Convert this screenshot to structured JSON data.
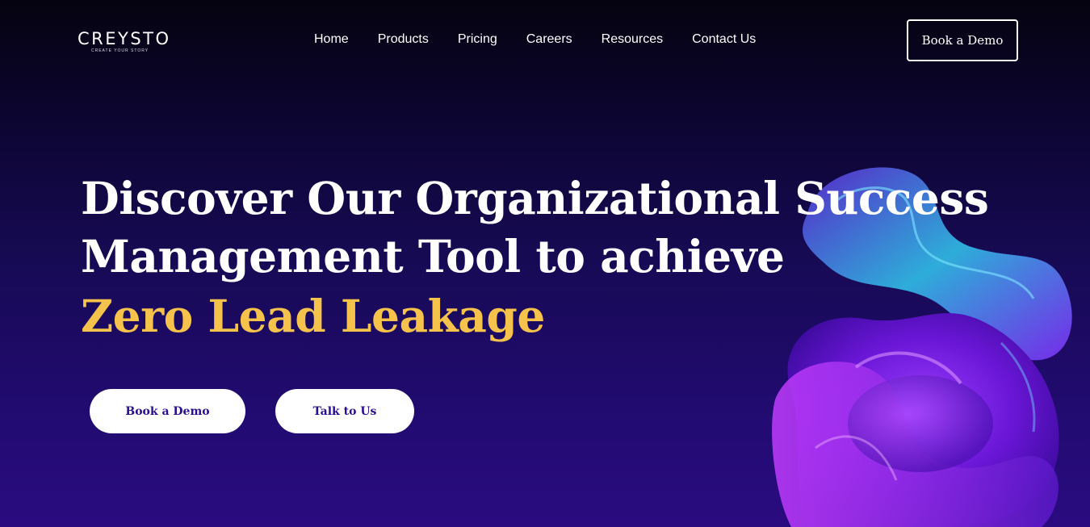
{
  "brand": {
    "name": "CREYSTO",
    "tagline": "CREATE YOUR STORY"
  },
  "nav": {
    "items": [
      {
        "label": "Home"
      },
      {
        "label": "Products"
      },
      {
        "label": "Pricing"
      },
      {
        "label": "Careers"
      },
      {
        "label": "Resources"
      },
      {
        "label": "Contact Us"
      }
    ],
    "cta_label": "Book a Demo"
  },
  "hero": {
    "title_line_1": "Discover Our Organizational Success",
    "title_line_2": "Management Tool to achieve",
    "highlight": "Zero Lead Leakage",
    "primary_button": "Book a Demo",
    "secondary_button": "Talk to Us"
  },
  "colors": {
    "highlight": "#f5c24c",
    "button_text": "#2a0e8f",
    "background_top": "#05030f",
    "background_bottom": "#2a0b80"
  },
  "decor": {
    "hero_art": "abstract-3d-glass-shape"
  }
}
